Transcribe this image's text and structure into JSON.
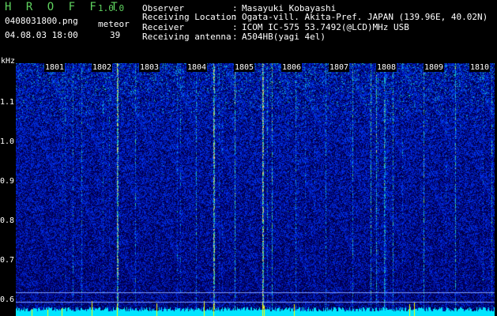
{
  "app": {
    "title": "H R O F F T",
    "version": "1.0.0"
  },
  "file": {
    "name": "0408031800.png",
    "datetime": "04.08.03 18:00"
  },
  "counter": {
    "label": "meteor",
    "value": "39"
  },
  "info": [
    {
      "label": "Observer",
      "value": "Masayuki Kobayashi"
    },
    {
      "label": "Receiving Location",
      "value": "Ogata-vill. Akita-Pref. JAPAN (139.96E, 40.02N)"
    },
    {
      "label": "Receiver",
      "value": "ICOM IC-575 53.7492(@LCD)MHz USB"
    },
    {
      "label": "Receiving antenna",
      "value": "A504HB(yagi 4el)"
    }
  ],
  "y_axis": {
    "unit": "kHz",
    "labels": [
      "1.1",
      "1.0",
      "0.9",
      "0.8",
      "0.7",
      "0.6"
    ]
  },
  "x_axis": {
    "labels": [
      "1801",
      "1802",
      "1803",
      "1804",
      "1805",
      "1806",
      "1807",
      "1808",
      "1809",
      "1810"
    ]
  },
  "colors": {
    "title": "#5fd35f",
    "background": "#000000",
    "spectrum": "#0a2fa0",
    "baseline": "#00e5ff",
    "meteor": "#ffff00"
  }
}
